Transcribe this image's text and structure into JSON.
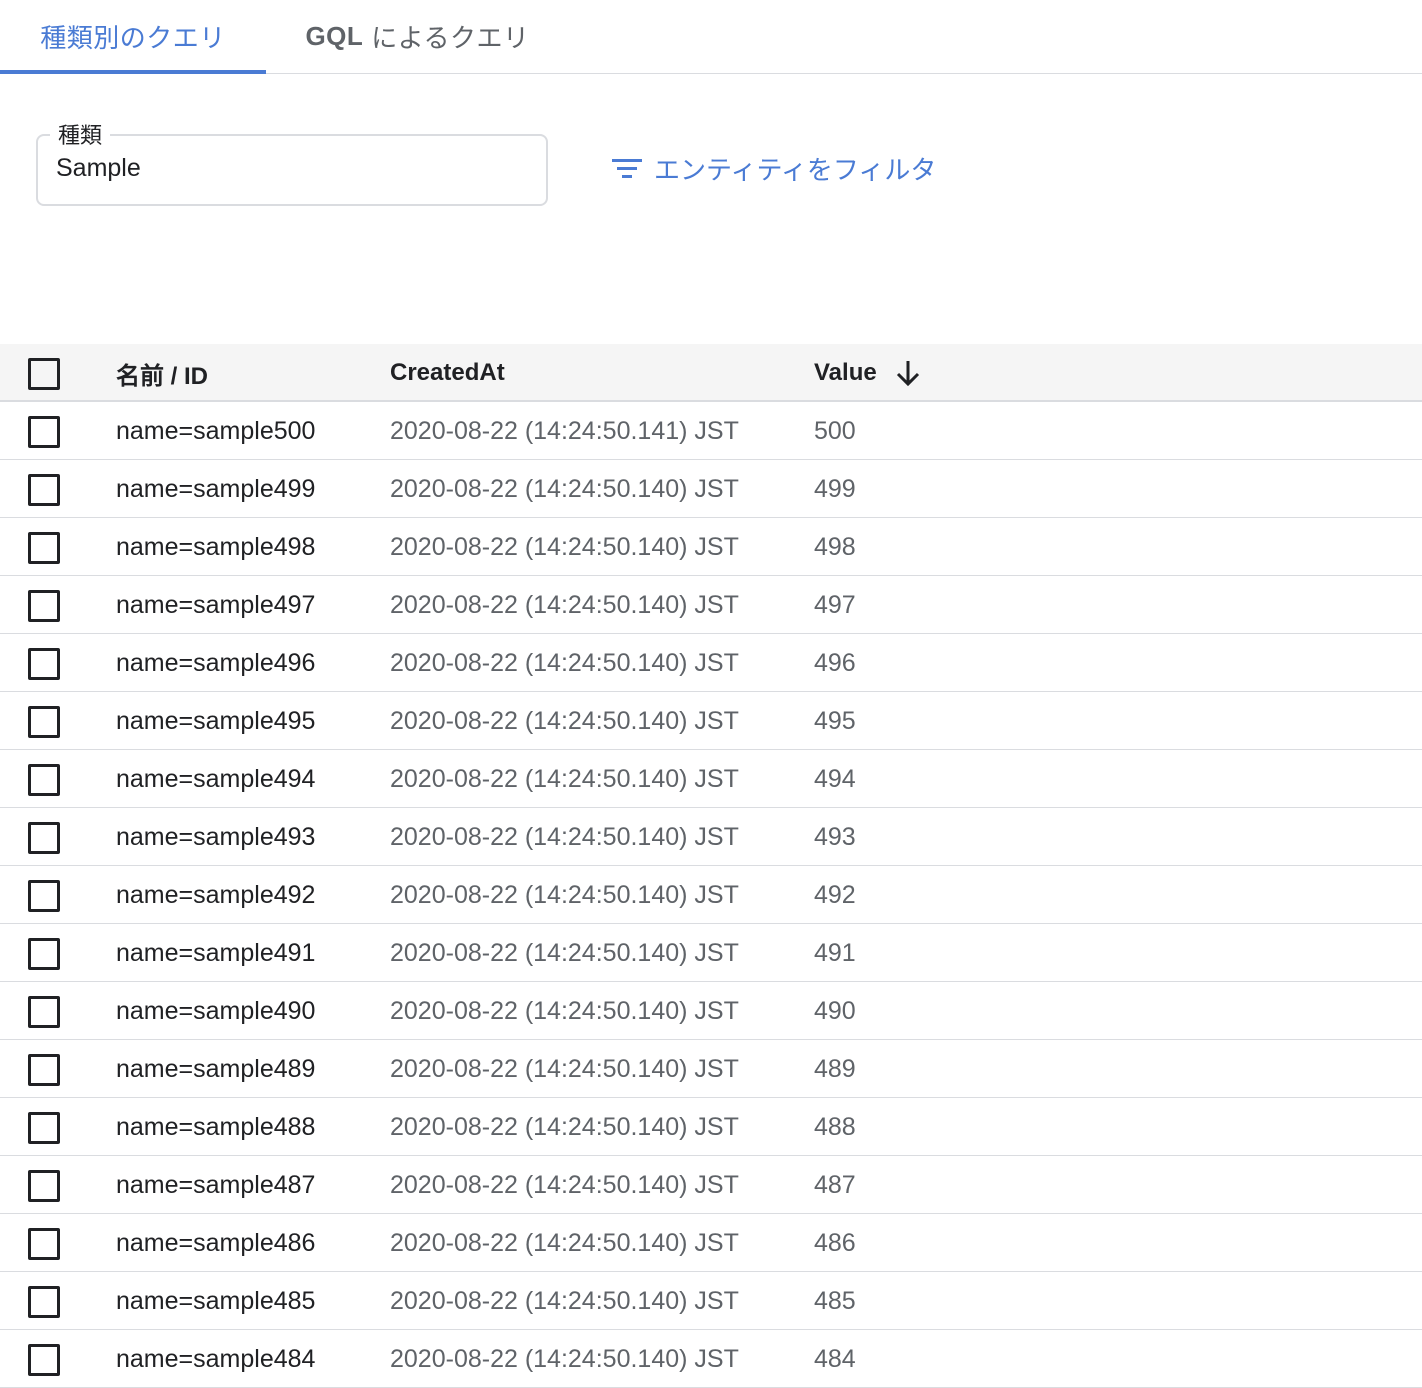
{
  "tabs": [
    {
      "label": "種類別のクエリ",
      "active": true
    },
    {
      "label_bold": "GQL",
      "label_rest": "によるクエリ",
      "active": false
    }
  ],
  "kind_field": {
    "label": "種類",
    "value": "Sample"
  },
  "filter_button": {
    "label": "エンティティをフィルタ",
    "icon": "filter-list-icon"
  },
  "table": {
    "columns": [
      "名前 / ID",
      "CreatedAt",
      "Value"
    ],
    "sort": {
      "column": "Value",
      "direction": "descending",
      "icon": "arrow-downward-icon"
    },
    "rows": [
      {
        "name": "name=sample500",
        "created_at": "2020-08-22 (14:24:50.141) JST",
        "value": "500"
      },
      {
        "name": "name=sample499",
        "created_at": "2020-08-22 (14:24:50.140) JST",
        "value": "499"
      },
      {
        "name": "name=sample498",
        "created_at": "2020-08-22 (14:24:50.140) JST",
        "value": "498"
      },
      {
        "name": "name=sample497",
        "created_at": "2020-08-22 (14:24:50.140) JST",
        "value": "497"
      },
      {
        "name": "name=sample496",
        "created_at": "2020-08-22 (14:24:50.140) JST",
        "value": "496"
      },
      {
        "name": "name=sample495",
        "created_at": "2020-08-22 (14:24:50.140) JST",
        "value": "495"
      },
      {
        "name": "name=sample494",
        "created_at": "2020-08-22 (14:24:50.140) JST",
        "value": "494"
      },
      {
        "name": "name=sample493",
        "created_at": "2020-08-22 (14:24:50.140) JST",
        "value": "493"
      },
      {
        "name": "name=sample492",
        "created_at": "2020-08-22 (14:24:50.140) JST",
        "value": "492"
      },
      {
        "name": "name=sample491",
        "created_at": "2020-08-22 (14:24:50.140) JST",
        "value": "491"
      },
      {
        "name": "name=sample490",
        "created_at": "2020-08-22 (14:24:50.140) JST",
        "value": "490"
      },
      {
        "name": "name=sample489",
        "created_at": "2020-08-22 (14:24:50.140) JST",
        "value": "489"
      },
      {
        "name": "name=sample488",
        "created_at": "2020-08-22 (14:24:50.140) JST",
        "value": "488"
      },
      {
        "name": "name=sample487",
        "created_at": "2020-08-22 (14:24:50.140) JST",
        "value": "487"
      },
      {
        "name": "name=sample486",
        "created_at": "2020-08-22 (14:24:50.140) JST",
        "value": "486"
      },
      {
        "name": "name=sample485",
        "created_at": "2020-08-22 (14:24:50.140) JST",
        "value": "485"
      },
      {
        "name": "name=sample484",
        "created_at": "2020-08-22 (14:24:50.140) JST",
        "value": "484"
      }
    ]
  },
  "colors": {
    "accent": "#4a7bd4",
    "text": "#202124",
    "muted": "#5f6368",
    "divider": "#dadce0",
    "header_bg": "#f5f5f5"
  }
}
